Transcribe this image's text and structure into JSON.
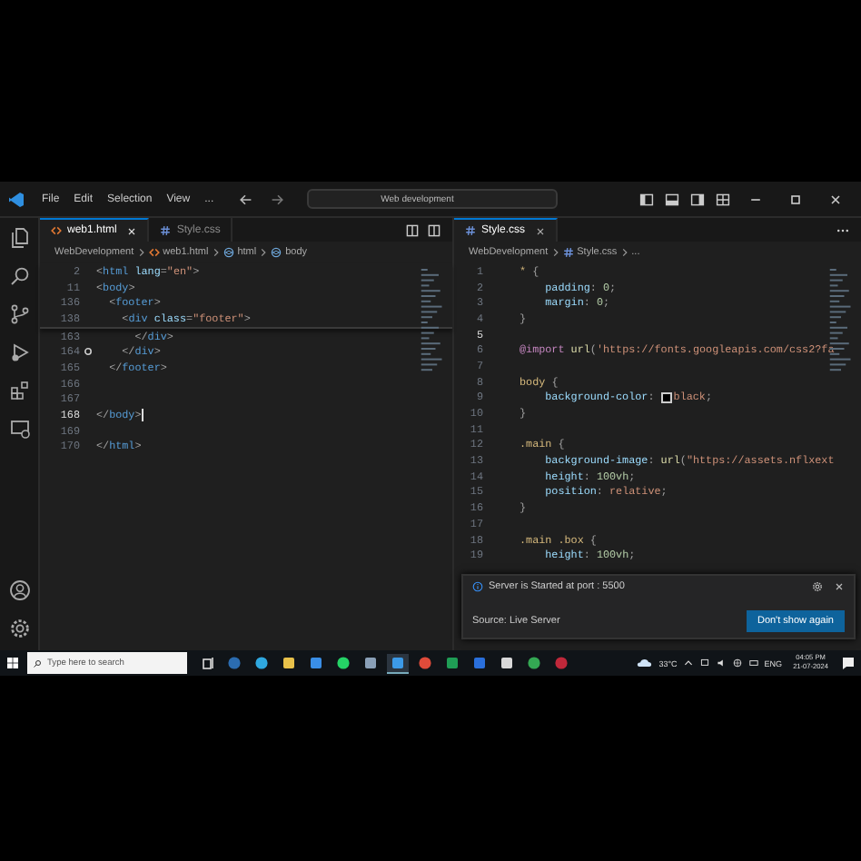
{
  "title_bar": {
    "menu": [
      "File",
      "Edit",
      "Selection",
      "View",
      "..."
    ],
    "search": "Web development"
  },
  "left_editor": {
    "tabs": [
      {
        "label": "web1.html",
        "kind": "html",
        "selected": true
      },
      {
        "label": "Style.css",
        "kind": "css",
        "selected": false
      }
    ],
    "breadcrumb": [
      {
        "label": "WebDevelopment",
        "kind": "folder"
      },
      {
        "label": "web1.html",
        "kind": "html"
      },
      {
        "label": "html",
        "kind": "element"
      },
      {
        "label": "body",
        "kind": "element"
      }
    ],
    "sticky_lines": [
      {
        "number": "2",
        "segments": [
          {
            "kind": "punct",
            "text": "<"
          },
          {
            "kind": "tag",
            "text": "html"
          },
          {
            "kind": "attr",
            "text": " lang"
          },
          {
            "kind": "punct",
            "text": "="
          },
          {
            "kind": "string",
            "text": "\"en\""
          },
          {
            "kind": "punct",
            "text": ">"
          }
        ]
      },
      {
        "number": "11",
        "segments": [
          {
            "kind": "punct",
            "text": "<"
          },
          {
            "kind": "tag",
            "text": "body"
          },
          {
            "kind": "punct",
            "text": ">"
          }
        ]
      },
      {
        "number": "136",
        "segments": [
          {
            "kind": "punct",
            "text": "  <"
          },
          {
            "kind": "tag",
            "text": "footer"
          },
          {
            "kind": "punct",
            "text": ">"
          }
        ]
      },
      {
        "number": "138",
        "segments": [
          {
            "kind": "punct",
            "text": "    <"
          },
          {
            "kind": "tag",
            "text": "div"
          },
          {
            "kind": "attr",
            "text": " class"
          },
          {
            "kind": "punct",
            "text": "="
          },
          {
            "kind": "string",
            "text": "\"footer\""
          },
          {
            "kind": "punct",
            "text": ">"
          }
        ]
      }
    ],
    "lines": [
      {
        "number": "163",
        "current": false,
        "marked": false,
        "segments": [
          {
            "kind": "punct",
            "text": "      </"
          },
          {
            "kind": "tag",
            "text": "div"
          },
          {
            "kind": "punct",
            "text": ">"
          }
        ]
      },
      {
        "number": "164",
        "current": false,
        "marked": true,
        "segments": [
          {
            "kind": "punct",
            "text": "    </"
          },
          {
            "kind": "tag",
            "text": "div"
          },
          {
            "kind": "punct",
            "text": ">"
          }
        ]
      },
      {
        "number": "165",
        "current": false,
        "marked": false,
        "segments": [
          {
            "kind": "punct",
            "text": "  </"
          },
          {
            "kind": "tag",
            "text": "footer"
          },
          {
            "kind": "punct",
            "text": ">"
          }
        ]
      },
      {
        "number": "166",
        "current": false,
        "marked": false
      },
      {
        "number": "167",
        "current": false,
        "marked": false
      },
      {
        "number": "168",
        "current": true,
        "marked": false,
        "segments": [
          {
            "kind": "punct",
            "text": "</"
          },
          {
            "kind": "tag",
            "text": "body"
          },
          {
            "kind": "punct",
            "text": ">"
          }
        ]
      },
      {
        "number": "169",
        "current": false,
        "marked": false
      },
      {
        "number": "170",
        "current": false,
        "marked": false,
        "segments": [
          {
            "kind": "punct",
            "text": "</"
          },
          {
            "kind": "tag",
            "text": "html"
          },
          {
            "kind": "punct",
            "text": ">"
          }
        ]
      }
    ]
  },
  "right_editor": {
    "tabs": [
      {
        "label": "Style.css",
        "kind": "css",
        "selected": true
      }
    ],
    "breadcrumb": [
      {
        "label": "WebDevelopment",
        "kind": "folder"
      },
      {
        "label": "Style.css",
        "kind": "css"
      },
      {
        "label": "...",
        "kind": "more"
      }
    ],
    "lines": [
      {
        "number": "1",
        "current": false,
        "segments": [
          {
            "kind": "selector",
            "text": "* "
          },
          {
            "kind": "punct",
            "text": "{"
          }
        ]
      },
      {
        "number": "2",
        "current": false,
        "segments": [
          {
            "kind": "property",
            "text": "    padding"
          },
          {
            "kind": "punct",
            "text": ": "
          },
          {
            "kind": "number",
            "text": "0"
          },
          {
            "kind": "punct",
            "text": ";"
          }
        ]
      },
      {
        "number": "3",
        "current": false,
        "segments": [
          {
            "kind": "property",
            "text": "    margin"
          },
          {
            "kind": "punct",
            "text": ": "
          },
          {
            "kind": "number",
            "text": "0"
          },
          {
            "kind": "punct",
            "text": ";"
          }
        ]
      },
      {
        "number": "4",
        "current": false,
        "segments": [
          {
            "kind": "punct",
            "text": "}"
          }
        ]
      },
      {
        "number": "5",
        "current": true
      },
      {
        "number": "6",
        "current": false,
        "segments": [
          {
            "kind": "keyword",
            "text": "@import"
          },
          {
            "kind": "function",
            "text": " url"
          },
          {
            "kind": "punct",
            "text": "("
          },
          {
            "kind": "string",
            "text": "'https://fonts.googleapis.com/css2?fa"
          }
        ]
      },
      {
        "number": "7",
        "current": false
      },
      {
        "number": "8",
        "current": false,
        "segments": [
          {
            "kind": "selector",
            "text": "body "
          },
          {
            "kind": "punct",
            "text": "{"
          }
        ]
      },
      {
        "number": "9",
        "current": false,
        "segments": [
          {
            "kind": "property",
            "text": "    background-color"
          },
          {
            "kind": "punct",
            "text": ": "
          },
          {
            "kind": "color",
            "text": "black"
          },
          {
            "kind": "punct",
            "text": ";"
          }
        ]
      },
      {
        "number": "10",
        "current": false,
        "segments": [
          {
            "kind": "punct",
            "text": "}"
          }
        ]
      },
      {
        "number": "11",
        "current": false
      },
      {
        "number": "12",
        "current": false,
        "segments": [
          {
            "kind": "selector",
            "text": ".main "
          },
          {
            "kind": "punct",
            "text": "{"
          }
        ]
      },
      {
        "number": "13",
        "current": false,
        "segments": [
          {
            "kind": "property",
            "text": "    background-image"
          },
          {
            "kind": "punct",
            "text": ": "
          },
          {
            "kind": "function",
            "text": "url"
          },
          {
            "kind": "punct",
            "text": "("
          },
          {
            "kind": "string",
            "text": "\"https://assets.nflxext"
          }
        ]
      },
      {
        "number": "14",
        "current": false,
        "segments": [
          {
            "kind": "property",
            "text": "    height"
          },
          {
            "kind": "punct",
            "text": ": "
          },
          {
            "kind": "number",
            "text": "100vh"
          },
          {
            "kind": "punct",
            "text": ";"
          }
        ]
      },
      {
        "number": "15",
        "current": false,
        "segments": [
          {
            "kind": "property",
            "text": "    position"
          },
          {
            "kind": "punct",
            "text": ": "
          },
          {
            "kind": "string",
            "text": "relative"
          },
          {
            "kind": "punct",
            "text": ";"
          }
        ]
      },
      {
        "number": "16",
        "current": false,
        "segments": [
          {
            "kind": "punct",
            "text": "}"
          }
        ]
      },
      {
        "number": "17",
        "current": false
      },
      {
        "number": "18",
        "current": false,
        "segments": [
          {
            "kind": "selector",
            "text": ".main .box "
          },
          {
            "kind": "punct",
            "text": "{"
          }
        ]
      },
      {
        "number": "19",
        "current": false,
        "segments": [
          {
            "kind": "property",
            "text": "    height"
          },
          {
            "kind": "punct",
            "text": ": "
          },
          {
            "kind": "number",
            "text": "100vh"
          },
          {
            "kind": "punct",
            "text": ";"
          }
        ]
      }
    ]
  },
  "notification": {
    "message": "Server is Started at port : 5500",
    "source": "Source: Live Server",
    "button": "Don't show again"
  },
  "taskbar": {
    "search_placeholder": "Type here to search",
    "weather": "33°C",
    "language": "ENG",
    "time": "04:05 PM",
    "date": "21-07-2024"
  }
}
